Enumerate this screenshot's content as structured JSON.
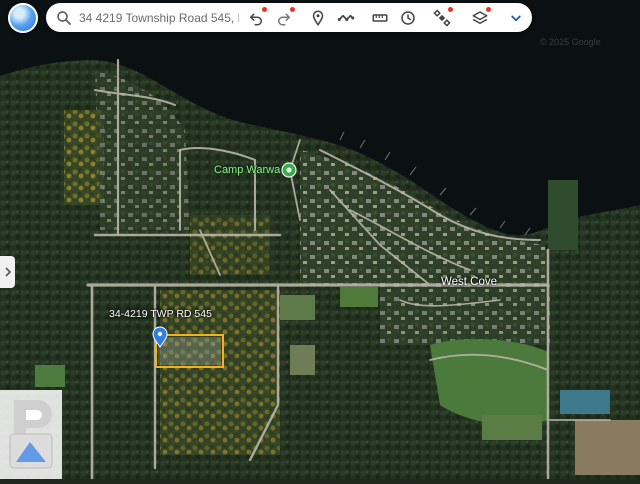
{
  "toolbar": {
    "search_value": "34 4219 Township Road 545, Dar",
    "icons": [
      "globe-icon",
      "search-icon",
      "undo-icon",
      "redo-icon",
      "location-pin-icon",
      "route-icon",
      "ruler-icon",
      "history-icon",
      "satellite-icon",
      "layers-icon",
      "chevron-down-icon"
    ]
  },
  "map": {
    "place_label": "Camp Warwa",
    "area_label": "West Cove",
    "parcel_label": "34-4219 TWP RD 545",
    "copyright": "© 2025 Google"
  },
  "colors": {
    "water": "#0b1113",
    "forest": "#22311f",
    "road": "#b9b6a8",
    "parcel_outline": "#f2b21c",
    "pin": "#2f7ee8",
    "label_green": "#8ff08f"
  }
}
